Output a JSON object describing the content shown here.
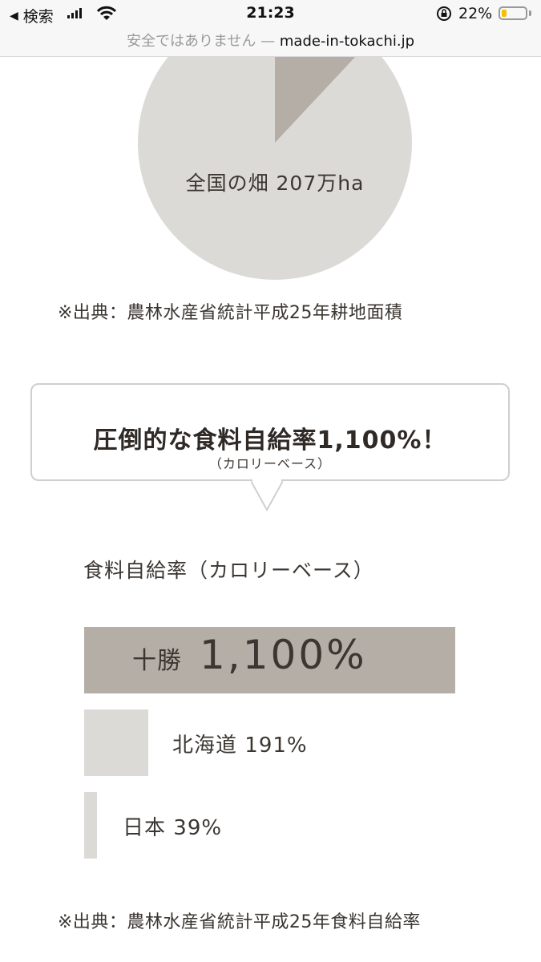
{
  "status_bar": {
    "back_label": "検索",
    "time": "21:23",
    "battery": "22%",
    "battery_fraction": 0.22
  },
  "url_bar": {
    "warning": "安全ではありません — ",
    "domain": "made-in-tokachi.jp"
  },
  "pie": {
    "label": "全国の畑 207万ha",
    "colors": {
      "base": "#dcdad6",
      "highlight": "#b5aea6"
    }
  },
  "source1": "※出典：農林水産省統計平成25年耕地面積",
  "bubble": {
    "title": "圧倒的な食料自給率1,100%！",
    "subtitle": "（カロリーベース）"
  },
  "chart_data": {
    "type": "bar",
    "orientation": "horizontal",
    "title": "食料自給率（カロリーベース）",
    "categories": [
      "十勝",
      "北海道",
      "日本"
    ],
    "values": [
      1100,
      191,
      39
    ],
    "value_labels": [
      "1,100%",
      "191%",
      "39%"
    ],
    "unit": "%",
    "colors": [
      "#b5aea6",
      "#dcdad6",
      "#dcdad6"
    ]
  },
  "source2": "※出典：農林水産省統計平成25年食料自給率"
}
